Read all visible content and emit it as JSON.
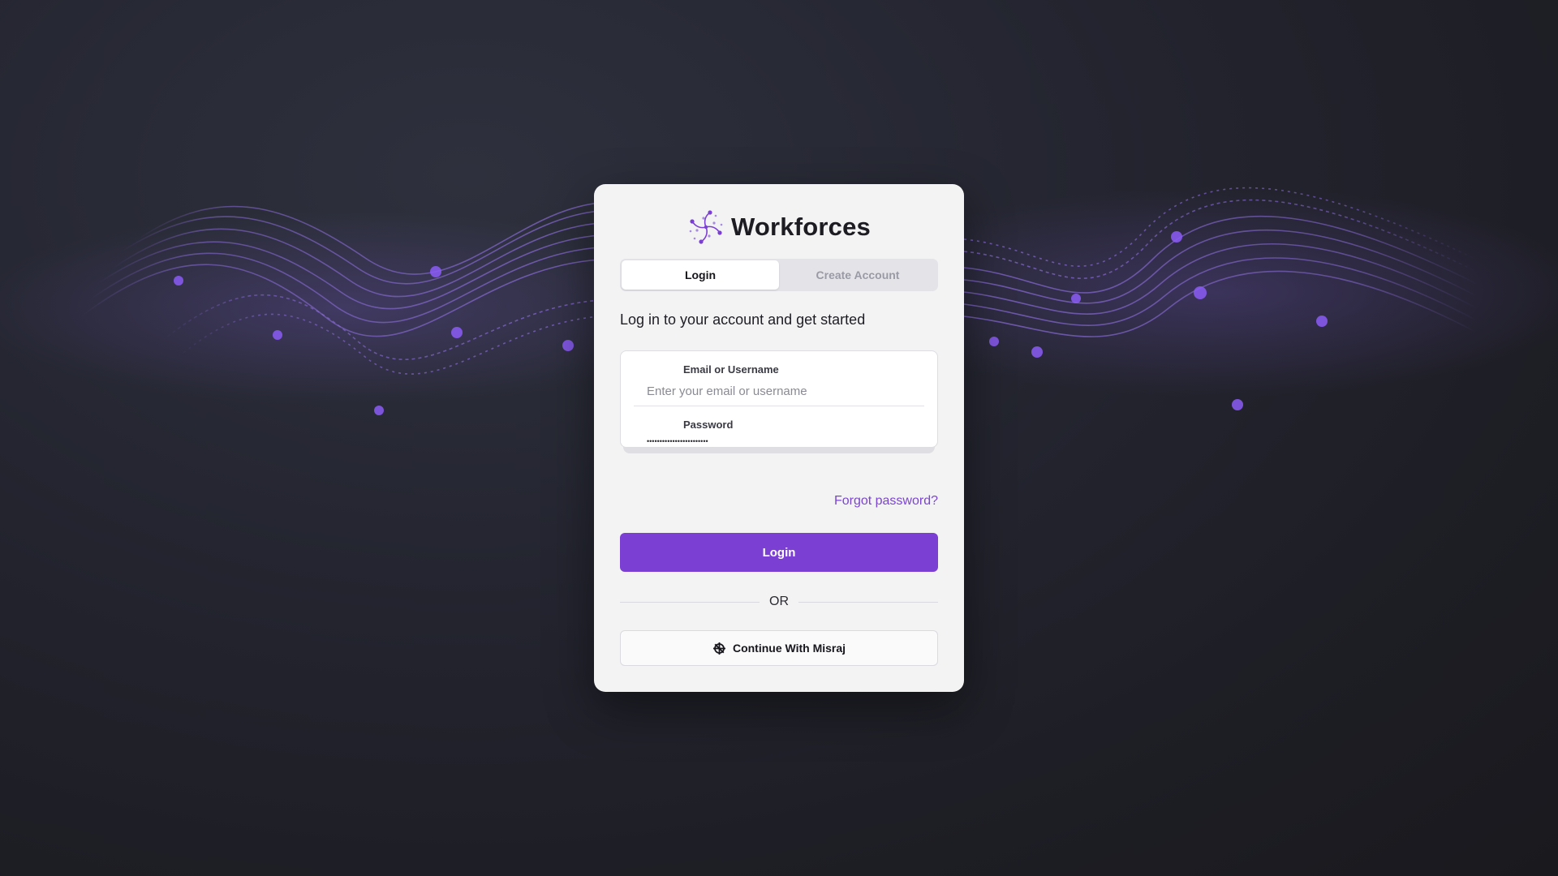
{
  "brand": {
    "name": "Workforces"
  },
  "tabs": [
    {
      "label": "Login",
      "active": true
    },
    {
      "label": "Create Account",
      "active": false
    }
  ],
  "subtitle": "Log in to your account and get started",
  "form": {
    "email_label": "Email or Username",
    "email_placeholder": "Enter your email or username",
    "email_value": "",
    "password_label": "Password",
    "password_value": "••••••••••••••••••••••••"
  },
  "forgot_password": "Forgot password?",
  "login_button": "Login",
  "or_text": "OR",
  "sso_button": "Continue With Misraj",
  "colors": {
    "accent": "#7b3fd4",
    "link": "#7b45cf",
    "card_bg": "#f3f3f4",
    "page_bg": "#1d1d24"
  }
}
